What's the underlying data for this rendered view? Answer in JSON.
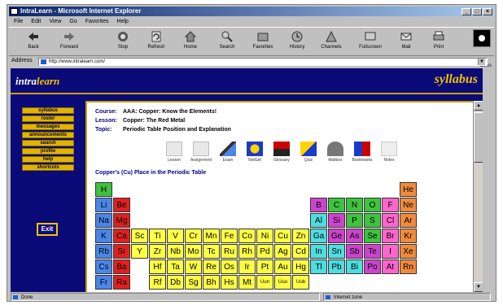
{
  "browser": {
    "title": "IntraLearn - Microsoft Internet Explorer",
    "menu": [
      "File",
      "Edit",
      "View",
      "Go",
      "Favorites",
      "Help"
    ],
    "toolbar": [
      "Back",
      "Forward",
      "Stop",
      "Refresh",
      "Home",
      "Search",
      "Favorites",
      "History",
      "Channels",
      "Fullscreen",
      "Mail",
      "Print"
    ],
    "links_label": "Links",
    "address_label": "Address",
    "address_value": "http://www.intralearn.com/",
    "status_text": "Done",
    "zone_text": "Internet zone"
  },
  "site": {
    "logo_part1": "intra",
    "logo_part2": "learn",
    "section": "syllabus",
    "nav": [
      "syllabus",
      "roster",
      "messages",
      "announcements",
      "search",
      "profile",
      "help",
      "shortcuts"
    ],
    "exit_label": "Exit"
  },
  "lesson": {
    "course_label": "Course:",
    "course_value": "AAA: Copper: Know the Elements!",
    "lesson_label": "Lesson:",
    "lesson_value": "Copper: The Red Metal",
    "topic_label": "Topic:",
    "topic_value": "Periodic Table Position and Explanation",
    "tools": [
      "Lesson",
      "Assignment",
      "Exam",
      "NetGet",
      "Glossary",
      "Quiz",
      "Mailbox",
      "Bookmarks",
      "Notes"
    ],
    "section_title": "Copper's (Cu) Place in the Periodic Table"
  },
  "periodic_table": [
    [
      "H",
      0,
      0,
      "#3fc23f"
    ],
    [
      "He",
      17,
      0,
      "#f08a3c"
    ],
    [
      "Li",
      0,
      1,
      "#4a86e8"
    ],
    [
      "Be",
      1,
      1,
      "#e02020"
    ],
    [
      "B",
      12,
      1,
      "#cc44cc"
    ],
    [
      "C",
      13,
      1,
      "#3fc23f"
    ],
    [
      "N",
      14,
      1,
      "#3fc23f"
    ],
    [
      "O",
      15,
      1,
      "#3fc23f"
    ],
    [
      "F",
      16,
      1,
      "#ff66cc"
    ],
    [
      "Ne",
      17,
      1,
      "#f08a3c"
    ],
    [
      "Na",
      0,
      2,
      "#4a86e8"
    ],
    [
      "Mg",
      1,
      2,
      "#e02020"
    ],
    [
      "Al",
      12,
      2,
      "#4fdde0"
    ],
    [
      "Si",
      13,
      2,
      "#cc44cc"
    ],
    [
      "P",
      14,
      2,
      "#3fc23f"
    ],
    [
      "S",
      15,
      2,
      "#3fc23f"
    ],
    [
      "Cl",
      16,
      2,
      "#ff66cc"
    ],
    [
      "Ar",
      17,
      2,
      "#f08a3c"
    ],
    [
      "K",
      0,
      3,
      "#4a86e8"
    ],
    [
      "Ca",
      1,
      3,
      "#e02020"
    ],
    [
      "Sc",
      2,
      3,
      "#ffff44"
    ],
    [
      "Ti",
      3,
      3,
      "#ffff44"
    ],
    [
      "V",
      4,
      3,
      "#ffff44"
    ],
    [
      "Cr",
      5,
      3,
      "#ffff44"
    ],
    [
      "Mn",
      6,
      3,
      "#ffff44"
    ],
    [
      "Fe",
      7,
      3,
      "#ffff44"
    ],
    [
      "Co",
      8,
      3,
      "#ffff44"
    ],
    [
      "Ni",
      9,
      3,
      "#ffff44"
    ],
    [
      "Cu",
      10,
      3,
      "#ffff44"
    ],
    [
      "Zn",
      11,
      3,
      "#ffff44"
    ],
    [
      "Ga",
      12,
      3,
      "#4fdde0"
    ],
    [
      "Ge",
      13,
      3,
      "#cc44cc"
    ],
    [
      "As",
      14,
      3,
      "#cc44cc"
    ],
    [
      "Se",
      15,
      3,
      "#3fc23f"
    ],
    [
      "Br",
      16,
      3,
      "#ff66cc"
    ],
    [
      "Kr",
      17,
      3,
      "#f08a3c"
    ],
    [
      "Rb",
      0,
      4,
      "#4a86e8"
    ],
    [
      "Sr",
      1,
      4,
      "#e02020"
    ],
    [
      "Y",
      2,
      4,
      "#ffff44"
    ],
    [
      "Zr",
      3,
      4,
      "#ffff44"
    ],
    [
      "Nb",
      4,
      4,
      "#ffff44"
    ],
    [
      "Mo",
      5,
      4,
      "#ffff44"
    ],
    [
      "Tc",
      6,
      4,
      "#ffff44"
    ],
    [
      "Ru",
      7,
      4,
      "#ffff44"
    ],
    [
      "Rh",
      8,
      4,
      "#ffff44"
    ],
    [
      "Pd",
      9,
      4,
      "#ffff44"
    ],
    [
      "Ag",
      10,
      4,
      "#ffff44"
    ],
    [
      "Cd",
      11,
      4,
      "#ffff44"
    ],
    [
      "In",
      12,
      4,
      "#4fdde0"
    ],
    [
      "Sn",
      13,
      4,
      "#4fdde0"
    ],
    [
      "Sb",
      14,
      4,
      "#cc44cc"
    ],
    [
      "Te",
      15,
      4,
      "#cc44cc"
    ],
    [
      "I",
      16,
      4,
      "#ff66cc"
    ],
    [
      "Xe",
      17,
      4,
      "#f08a3c"
    ],
    [
      "Cs",
      0,
      5,
      "#4a86e8"
    ],
    [
      "Ba",
      1,
      5,
      "#e02020"
    ],
    [
      "Hf",
      3,
      5,
      "#ffff44"
    ],
    [
      "Ta",
      4,
      5,
      "#ffff44"
    ],
    [
      "W",
      5,
      5,
      "#ffff44"
    ],
    [
      "Re",
      6,
      5,
      "#ffff44"
    ],
    [
      "Os",
      7,
      5,
      "#ffff44"
    ],
    [
      "Ir",
      8,
      5,
      "#ffff44"
    ],
    [
      "Pt",
      9,
      5,
      "#ffff44"
    ],
    [
      "Au",
      10,
      5,
      "#ffff44"
    ],
    [
      "Hg",
      11,
      5,
      "#ffff44"
    ],
    [
      "Tl",
      12,
      5,
      "#4fdde0"
    ],
    [
      "Pb",
      13,
      5,
      "#4fdde0"
    ],
    [
      "Bi",
      14,
      5,
      "#4fdde0"
    ],
    [
      "Po",
      15,
      5,
      "#cc44cc"
    ],
    [
      "At",
      16,
      5,
      "#ff66cc"
    ],
    [
      "Rn",
      17,
      5,
      "#f08a3c"
    ],
    [
      "Fr",
      0,
      6,
      "#4a86e8"
    ],
    [
      "Ra",
      1,
      6,
      "#e02020"
    ],
    [
      "Rf",
      3,
      6,
      "#ffff44"
    ],
    [
      "Db",
      4,
      6,
      "#ffff44"
    ],
    [
      "Sg",
      5,
      6,
      "#ffff44"
    ],
    [
      "Bh",
      6,
      6,
      "#ffff44"
    ],
    [
      "Hs",
      7,
      6,
      "#ffff44"
    ],
    [
      "Mt",
      8,
      6,
      "#ffff44"
    ],
    [
      "Uun",
      9,
      6,
      "#ffff44"
    ],
    [
      "Uuu",
      10,
      6,
      "#ffff44"
    ],
    [
      "Uub",
      11,
      6,
      "#ffff44"
    ]
  ]
}
